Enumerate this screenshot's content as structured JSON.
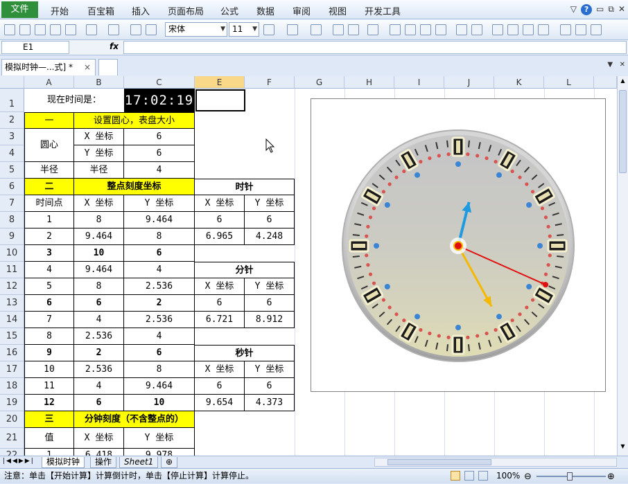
{
  "menubar": {
    "file": "文件",
    "items": [
      "开始",
      "百宝箱",
      "插入",
      "页面布局",
      "公式",
      "数据",
      "审阅",
      "视图",
      "开发工具"
    ]
  },
  "toolbar": {
    "font_name": "宋体",
    "font_size": "11"
  },
  "formula_bar": {
    "name_box": "E1",
    "fx": "fx",
    "formula": ""
  },
  "document_tab": {
    "title": "模拟时钟—...式] *",
    "close": "×"
  },
  "columns": [
    "A",
    "B",
    "C",
    "E",
    "F",
    "G",
    "H",
    "I",
    "J",
    "K",
    "L"
  ],
  "rows": [
    "1",
    "2",
    "3",
    "4",
    "5",
    "6",
    "7",
    "8",
    "9",
    "10",
    "11",
    "12",
    "13",
    "14",
    "15",
    "16",
    "17",
    "18",
    "19",
    "20",
    "21",
    "22"
  ],
  "cells": {
    "a1": "现在时间是：",
    "c1": "17:02:19",
    "a2": "一",
    "b2": "设置圆心，表盘大小",
    "a3": "圆心",
    "b3": "X 坐标",
    "c3": "6",
    "b4": "Y 坐标",
    "c4": "6",
    "a5": "半径",
    "b5": "半径",
    "c5": "4",
    "a6": "二",
    "b6": "整点刻度坐标",
    "e6": "时针",
    "a7": "时间点",
    "b7": "X 坐标",
    "c7": "Y 坐标",
    "e7": "X 坐标",
    "f7": "Y 坐标",
    "data": [
      [
        "1",
        "8",
        "9.464"
      ],
      [
        "2",
        "9.464",
        "8"
      ],
      [
        "3",
        "10",
        "6"
      ],
      [
        "4",
        "9.464",
        "4"
      ],
      [
        "5",
        "8",
        "2.536"
      ],
      [
        "6",
        "6",
        "2"
      ],
      [
        "7",
        "4",
        "2.536"
      ],
      [
        "8",
        "2.536",
        "4"
      ],
      [
        "9",
        "2",
        "6"
      ],
      [
        "10",
        "2.536",
        "8"
      ],
      [
        "11",
        "4",
        "9.464"
      ],
      [
        "12",
        "6",
        "10"
      ]
    ],
    "e8": "6",
    "f8": "6",
    "e9": "6.965",
    "f9": "4.248",
    "e11": "分针",
    "e12": "X 坐标",
    "f12": "Y 坐标",
    "e13": "6",
    "f13": "6",
    "e14": "6.721",
    "f14": "8.912",
    "e16": "秒针",
    "e17": "X 坐标",
    "f17": "Y 坐标",
    "e18": "6",
    "f18": "6",
    "e19": "9.654",
    "f19": "4.373",
    "a20": "三",
    "b20": "分钟刻度（不含整点的）",
    "a21": "值",
    "b21": "X 坐标",
    "c21": "Y 坐标",
    "a22": "1",
    "b22": "6.418",
    "c22": "9.978"
  },
  "sheet_tabs": [
    "模拟时钟",
    "操作",
    "Sheet1"
  ],
  "status": {
    "text": "注意：单击【开始计算】计算倒计时，单击【停止计算】计算停止。",
    "zoom": "100%"
  },
  "colors": {
    "hour_hand": "#f5b800",
    "minute_hand": "#1e9be0",
    "second_hand": "#e01010",
    "minute_dot": "#d9534f",
    "hour_dot": "#3a86d4",
    "dial": "#c8c8c8"
  }
}
